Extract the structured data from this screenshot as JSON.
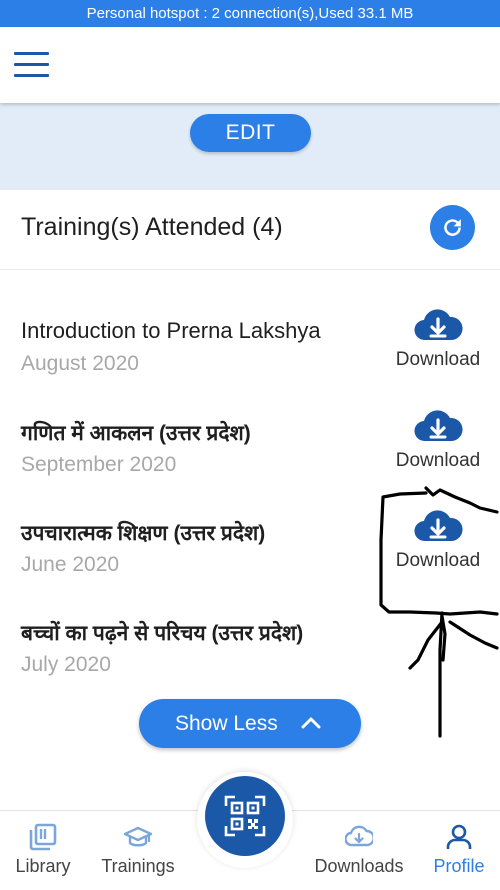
{
  "status_bar": {
    "text": "Personal hotspot : 2 connection(s),Used  33.1 MB"
  },
  "profile": {
    "edit_label": "EDIT"
  },
  "trainings": {
    "heading": "Training(s) Attended (4)",
    "items": [
      {
        "title": "Introduction to Prerna Lakshya",
        "date": "August 2020",
        "download_label": "Download"
      },
      {
        "title": "गणित में आकलन (उत्तर प्रदेश)",
        "date": "September 2020",
        "download_label": "Download"
      },
      {
        "title": "उपचारात्मक शिक्षण (उत्तर प्रदेश)",
        "date": "June 2020",
        "download_label": "Download"
      },
      {
        "title": "बच्चों का पढ़ने से परिचय (उत्तर प्रदेश)",
        "date": "July 2020"
      }
    ],
    "show_less_label": "Show Less"
  },
  "bottom_nav": {
    "items": [
      {
        "label": "Library",
        "icon": "library-icon"
      },
      {
        "label": "Trainings",
        "icon": "graduation-cap-icon"
      },
      {
        "label": "Downloads",
        "icon": "cloud-download-icon"
      },
      {
        "label": "Profile",
        "icon": "person-icon"
      }
    ],
    "active": "Profile",
    "center_icon": "qr-code-icon"
  },
  "colors": {
    "primary": "#2b7fe6",
    "dark_primary": "#1c58a8",
    "band": "#e2ecf9",
    "muted_text": "#a8a8a8"
  }
}
